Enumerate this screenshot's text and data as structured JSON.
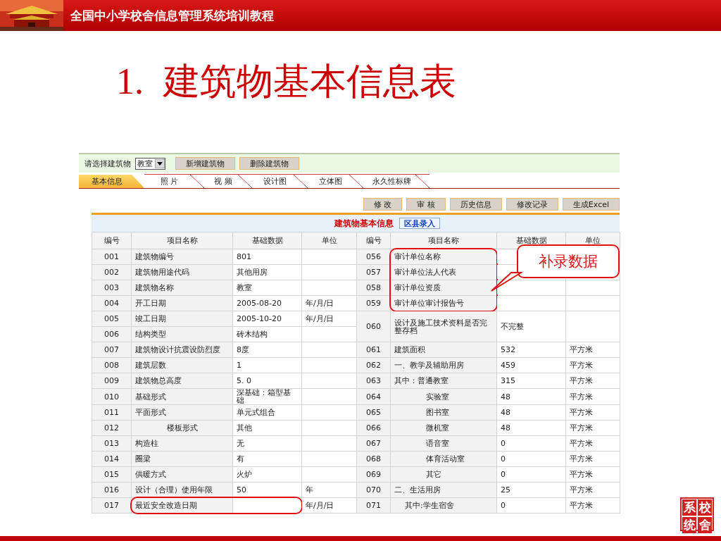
{
  "slide": {
    "header_title": "全国中小学校舍信息管理系统培训教程",
    "number": "1.",
    "title": "建筑物基本信息表",
    "seal": [
      "系",
      "校",
      "统",
      "舍"
    ]
  },
  "toolbar": {
    "label": "请选择建筑物",
    "select_value": "教室",
    "buttons": [
      "新增建筑物",
      "删除建筑物"
    ]
  },
  "tabs": [
    {
      "label": "基本信息",
      "selected": true
    },
    {
      "label": "照 片",
      "selected": false
    },
    {
      "label": "视 频",
      "selected": false
    },
    {
      "label": "设计图",
      "selected": false
    },
    {
      "label": "立体图",
      "selected": false
    },
    {
      "label": "永久性标牌",
      "selected": false
    }
  ],
  "actions": [
    "修 改",
    "审 核",
    "历史信息",
    "修改记录",
    "生成Excel"
  ],
  "panel": {
    "title": "建筑物基本信息",
    "badge": "区县录入"
  },
  "table": {
    "columns": [
      "编号",
      "项目名称",
      "基础数据",
      "单位",
      "编号",
      "项目名称",
      "基础数据",
      "单位"
    ],
    "left_rows": [
      {
        "no": "001",
        "name": "建筑物编号",
        "value": "801",
        "kind": "plain",
        "highlight": false
      },
      {
        "no": "002",
        "name": "建筑物用途代码",
        "value": "其他用房",
        "kind": "plain",
        "highlight": false
      },
      {
        "no": "003",
        "name": "建筑物名称",
        "value": "教室",
        "kind": "plain",
        "highlight": false
      },
      {
        "no": "004",
        "name": "开工日期",
        "value": "2005-08-20",
        "unit": "年/月/日",
        "kind": "plain",
        "highlight": false
      },
      {
        "no": "005",
        "name": "竣工日期",
        "value": "2005-10-20",
        "unit": "年/月/日",
        "kind": "plain",
        "highlight": false
      },
      {
        "no": "006",
        "name": "结构类型",
        "value": "砖木结构",
        "kind": "plain",
        "highlight": false
      },
      {
        "no": "007",
        "name": "建筑物设计抗震设防烈度",
        "value": "8度",
        "kind": "plain",
        "highlight": false
      },
      {
        "no": "008",
        "name": "建筑层数",
        "value": "1",
        "kind": "plain",
        "highlight": false
      },
      {
        "no": "009",
        "name": "建筑物总高度",
        "value": "5. 0",
        "kind": "plain",
        "highlight": false
      },
      {
        "no": "010",
        "name": "基础形式",
        "value": "深基础：箱型基础",
        "kind": "plain",
        "highlight": false
      },
      {
        "no": "011",
        "name": "平面形式",
        "value": "单元式组合",
        "kind": "plain",
        "highlight": false
      },
      {
        "no": "012",
        "name": "楼板形式",
        "value": "其他",
        "kind": "sub",
        "highlight": false
      },
      {
        "no": "013",
        "name": "构造柱",
        "value": "无",
        "kind": "plain",
        "highlight": false
      },
      {
        "no": "014",
        "name": "圈梁",
        "value": "有",
        "kind": "plain",
        "highlight": false
      },
      {
        "no": "015",
        "name": "供暖方式",
        "value": "火炉",
        "kind": "plain",
        "highlight": false
      },
      {
        "no": "016",
        "name": "设计（合理）使用年限",
        "value": "50",
        "unit": "年",
        "kind": "plain",
        "highlight": false
      },
      {
        "no": "017",
        "name": "最近安全改造日期",
        "unit": "年/月/日",
        "kind": "plain",
        "highlight": true
      }
    ],
    "right_rows": [
      {
        "no": "056",
        "name": "审计单位名称",
        "kind": "plain",
        "highlight": true
      },
      {
        "no": "057",
        "name": "审计单位法人代表",
        "kind": "plain",
        "highlight": true
      },
      {
        "no": "058",
        "name": "审计单位资质",
        "kind": "plain",
        "highlight": true
      },
      {
        "no": "059",
        "name": "审计单位审计报告号",
        "kind": "plain",
        "highlight": true
      },
      {
        "no": "060",
        "name": "设计及施工技术资料是否完整存档",
        "value": "不完整",
        "kind": "double",
        "highlight": false
      },
      {
        "no": "061",
        "name": "建筑面积",
        "value": "532",
        "unit": "平方米",
        "kind": "plain",
        "highlight": false
      },
      {
        "no": "062",
        "name": "一、教学及辅助用房",
        "value": "459",
        "unit": "平方米",
        "kind": "plain",
        "highlight": false
      },
      {
        "no": "063",
        "name": "其中：普通教室",
        "value": "315",
        "unit": "平方米",
        "kind": "plain",
        "highlight": false
      },
      {
        "no": "064",
        "name": "实验室",
        "value": "48",
        "unit": "平方米",
        "kind": "sub",
        "highlight": false
      },
      {
        "no": "065",
        "name": "图书室",
        "value": "48",
        "unit": "平方米",
        "kind": "sub",
        "highlight": false
      },
      {
        "no": "066",
        "name": "微机室",
        "value": "48",
        "unit": "平方米",
        "kind": "sub",
        "highlight": false
      },
      {
        "no": "067",
        "name": "语音室",
        "value": "0",
        "unit": "平方米",
        "kind": "sub",
        "highlight": false
      },
      {
        "no": "068",
        "name": "体育活动室",
        "value": "0",
        "unit": "平方米",
        "kind": "sub",
        "highlight": false
      },
      {
        "no": "069",
        "name": "其它",
        "value": "0",
        "unit": "平方米",
        "kind": "sub",
        "highlight": false
      },
      {
        "no": "070",
        "name": "二、生活用房",
        "value": "25",
        "unit": "平方米",
        "kind": "plain",
        "highlight": false
      },
      {
        "no": "071",
        "name": "其中:学生宿舍",
        "value": "0",
        "unit": "平方米",
        "kind": "minor",
        "highlight": false
      }
    ]
  },
  "callout": {
    "text": "补录数据"
  }
}
